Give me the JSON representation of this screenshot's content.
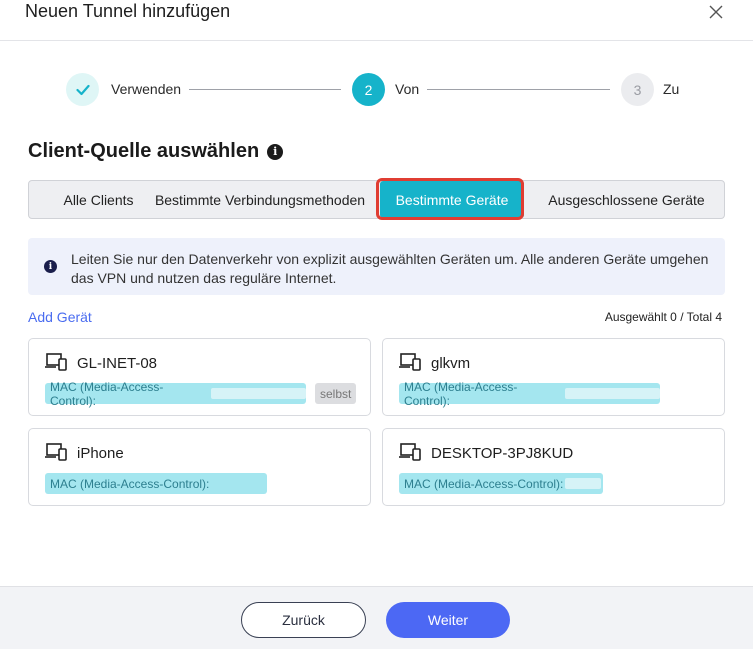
{
  "dialog": {
    "title": "Neuen Tunnel hinzufügen"
  },
  "stepper": {
    "steps": [
      {
        "number": "✓",
        "label": "Verwenden",
        "state": "done"
      },
      {
        "number": "2",
        "label": "Von",
        "state": "active"
      },
      {
        "number": "3",
        "label": "Zu",
        "state": "pending"
      }
    ]
  },
  "section": {
    "title": "Client-Quelle auswählen"
  },
  "tabs": [
    {
      "label": "Alle Clients",
      "active": false
    },
    {
      "label": "Bestimmte Verbindungsmethoden",
      "active": false
    },
    {
      "label": "Bestimmte Geräte",
      "active": true
    },
    {
      "label": "Ausgeschlossene Geräte",
      "active": false
    }
  ],
  "info": {
    "text": "Leiten Sie nur den Datenverkehr von explizit ausgewählten Geräten um. Alle anderen Geräte umgehen das VPN und nutzen das reguläre Internet."
  },
  "devices_header": {
    "add_label": "Add Gerät",
    "count_label": "Ausgewählt 0 / Total 4"
  },
  "devices": [
    {
      "name": "GL-INET-08",
      "mac_label": "MAC (Media-Access-Control):",
      "badge": "selbst",
      "icon": "devices-icon"
    },
    {
      "name": "glkvm",
      "mac_label": "MAC (Media-Access-Control):",
      "icon": "devices-icon"
    },
    {
      "name": "iPhone",
      "mac_label": "MAC (Media-Access-Control):",
      "icon": "devices-icon"
    },
    {
      "name": "DESKTOP-3PJ8KUD",
      "mac_label": "MAC (Media-Access-Control):",
      "icon": "devices-icon"
    }
  ],
  "footer": {
    "back_label": "Zurück",
    "next_label": "Weiter"
  },
  "colors": {
    "accent_teal": "#16b3ca",
    "primary_blue": "#4c68f4",
    "highlight_red": "#e03d32",
    "step_done_bg": "#dff6f6"
  }
}
